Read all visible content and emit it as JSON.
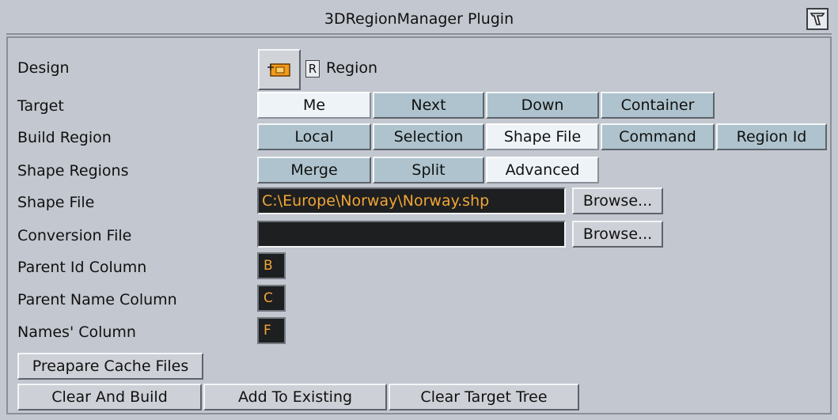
{
  "window": {
    "title": "3DRegionManager Plugin",
    "corner_icon": "plugin-icon"
  },
  "design": {
    "label": "Design",
    "r_label": "R",
    "name": "Region",
    "icon": "region-design-icon"
  },
  "target": {
    "label": "Target",
    "options": [
      "Me",
      "Next",
      "Down",
      "Container"
    ],
    "selected": "Me"
  },
  "build_region": {
    "label": "Build Region",
    "options": [
      "Local",
      "Selection",
      "Shape File",
      "Command",
      "Region Id"
    ],
    "selected": "Shape File"
  },
  "shape_regions": {
    "label": "Shape Regions",
    "options": [
      "Merge",
      "Split",
      "Advanced"
    ],
    "selected": "Advanced"
  },
  "shape_file": {
    "label": "Shape File",
    "value": "C:\\Europe\\Norway\\Norway.shp",
    "browse": "Browse..."
  },
  "conversion_file": {
    "label": "Conversion File",
    "value": "",
    "browse": "Browse..."
  },
  "parent_id_column": {
    "label": "Parent Id Column",
    "value": "B"
  },
  "parent_name_column": {
    "label": "Parent Name Column",
    "value": "C"
  },
  "names_column": {
    "label": "Names' Column",
    "value": "F"
  },
  "actions": {
    "prepare_cache": "Preapare Cache Files",
    "clear_and_build": "Clear And Build",
    "add_to_existing": "Add To Existing",
    "clear_target_tree": "Clear Target Tree"
  },
  "colors": {
    "background": "#c3c7cf",
    "button": "#aec3cd",
    "selected_button": "#eef3f8",
    "field": "#1e1f20",
    "field_text": "#f0a637"
  }
}
